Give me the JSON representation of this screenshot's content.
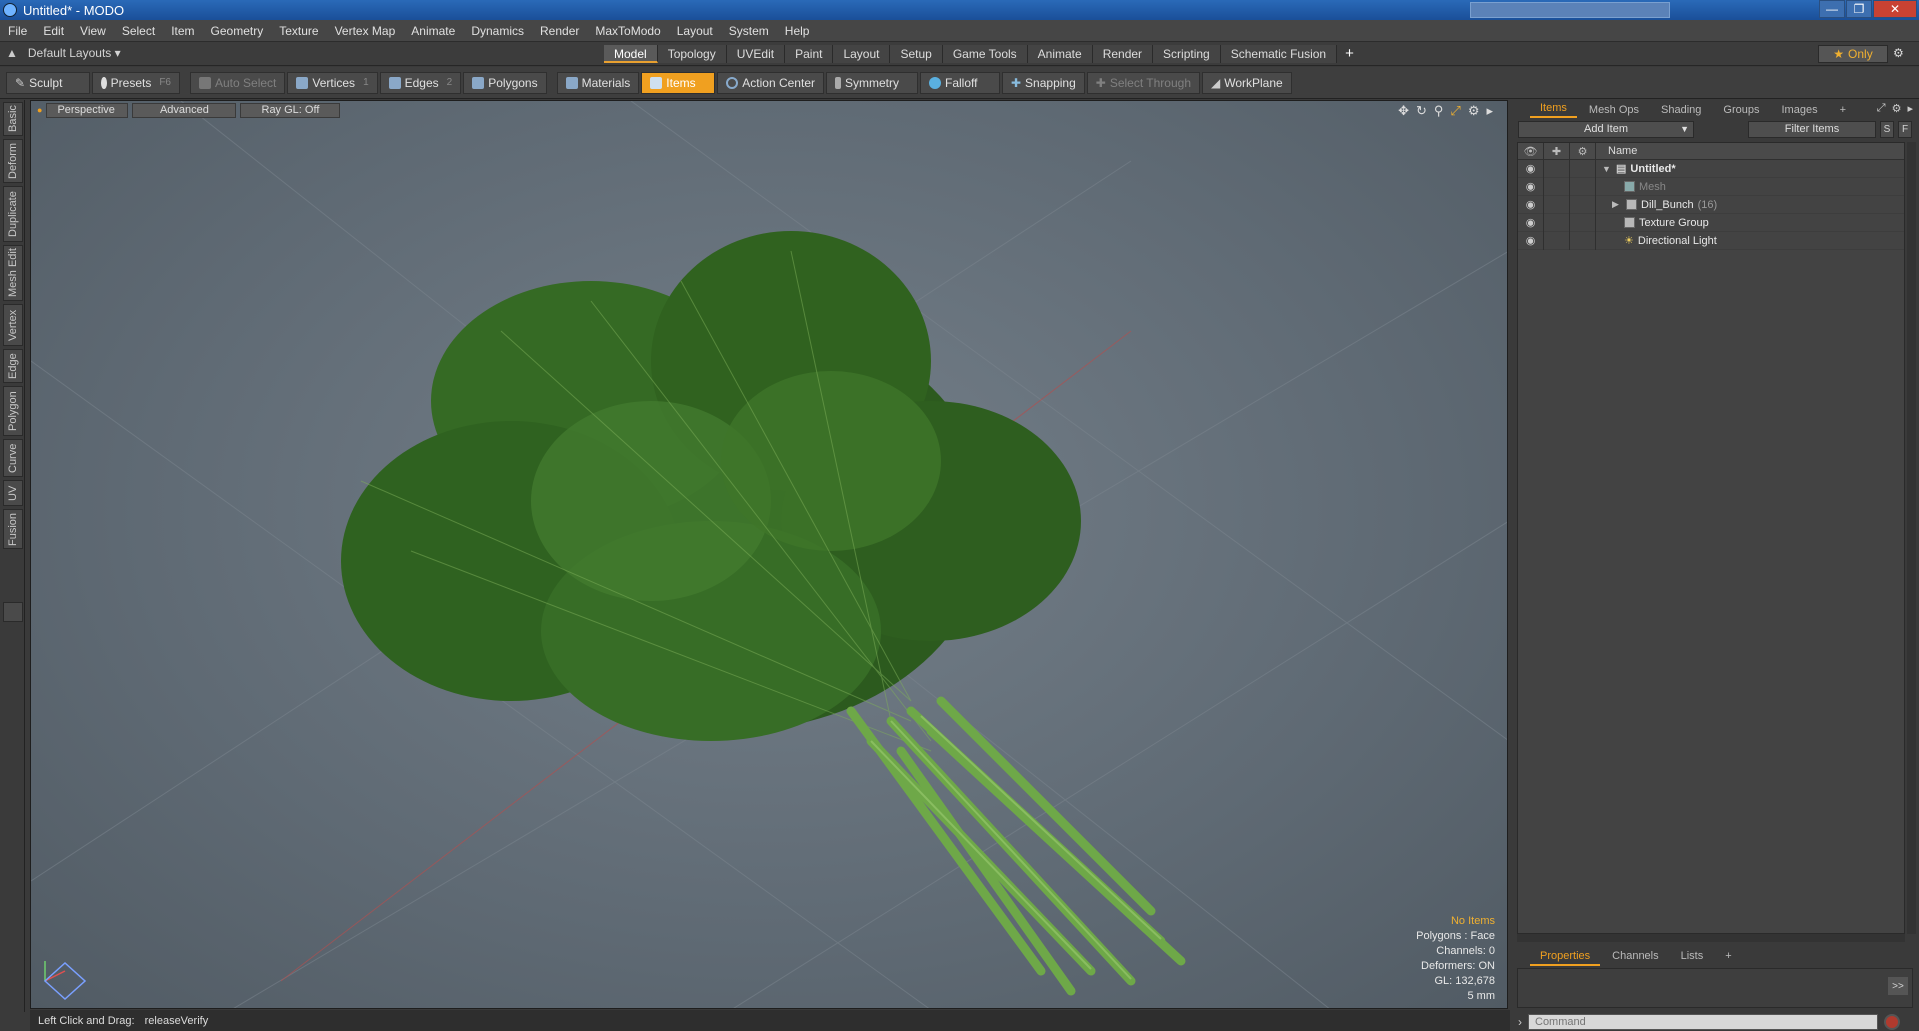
{
  "window": {
    "title": "Untitled* - MODO"
  },
  "menu": [
    "File",
    "Edit",
    "View",
    "Select",
    "Item",
    "Geometry",
    "Texture",
    "Vertex Map",
    "Animate",
    "Dynamics",
    "Render",
    "MaxToModo",
    "Layout",
    "System",
    "Help"
  ],
  "layout": {
    "default_layouts": "Default Layouts",
    "tabs": [
      "Model",
      "Topology",
      "UVEdit",
      "Paint",
      "Layout",
      "Setup",
      "Game Tools",
      "Animate",
      "Render",
      "Scripting",
      "Schematic Fusion"
    ],
    "active_tab": "Model",
    "plus": "+",
    "only_label": "Only"
  },
  "toolbar": {
    "sculpt": "Sculpt",
    "presets": "Presets",
    "presets_key": "F6",
    "auto_select": "Auto Select",
    "vertices": "Vertices",
    "vertices_key": "1",
    "edges": "Edges",
    "edges_key": "2",
    "polygons": "Polygons",
    "materials": "Materials",
    "items": "Items",
    "action_center": "Action Center",
    "symmetry": "Symmetry",
    "falloff": "Falloff",
    "snapping": "Snapping",
    "select_through": "Select Through",
    "workplane": "WorkPlane"
  },
  "left_tabs": [
    "Basic",
    "Deform",
    "Duplicate",
    "Mesh Edit",
    "Vertex",
    "Edge",
    "Polygon",
    "Curve",
    "UV",
    "Fusion"
  ],
  "viewport": {
    "perspective": "Perspective",
    "advanced": "Advanced",
    "raygl": "Ray GL: Off",
    "info": {
      "no_items": "No Items",
      "polygons": "Polygons : Face",
      "channels": "Channels: 0",
      "deformers": "Deformers: ON",
      "gl": "GL: 132,678",
      "scale": "5 mm"
    }
  },
  "status": {
    "hint": "Left Click and Drag:",
    "action": "releaseVerify"
  },
  "items_panel": {
    "tabs": [
      "Items",
      "Mesh Ops",
      "Shading",
      "Groups",
      "Images"
    ],
    "active_tab": "Items",
    "add_item": "Add Item",
    "filter_items": "Filter Items",
    "s_btn": "S",
    "f_btn": "F",
    "name_col": "Name",
    "rows": [
      {
        "label": "Untitled*",
        "count": ""
      },
      {
        "label": "Mesh",
        "count": ""
      },
      {
        "label": "Dill_Bunch",
        "count": "(16)"
      },
      {
        "label": "Texture Group",
        "count": ""
      },
      {
        "label": "Directional Light",
        "count": ""
      }
    ]
  },
  "props_panel": {
    "tabs": [
      "Properties",
      "Channels",
      "Lists"
    ],
    "active_tab": "Properties",
    "go": ">>"
  },
  "command": {
    "placeholder": "Command"
  },
  "colors": {
    "accent": "#f0a020",
    "viewport_bg": "#67727c",
    "dill_green": "#3a7a2a"
  }
}
